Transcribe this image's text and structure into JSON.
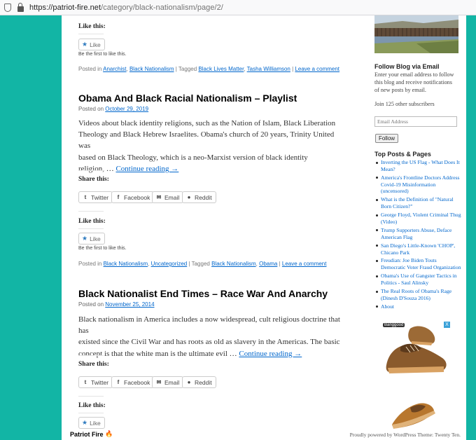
{
  "browser": {
    "url_host": "https://patriot-fire.net",
    "url_path": "/category/black-nationalism/page/2/"
  },
  "post_top": {
    "like_heading": "Like this:",
    "like_label": "Like",
    "like_note": "Be the first to like this.",
    "posted_in": "Posted in",
    "categories": [
      "Anarchist",
      "Black Nationalism"
    ],
    "tagged": "Tagged",
    "tags": [
      "Black Lives Matter",
      "Tasha Williamson"
    ],
    "leave_comment": "Leave a comment"
  },
  "post_1": {
    "title": "Obama And Black Racial Nationalism – Playlist",
    "posted_on": "Posted on",
    "date": "October 29, 2019",
    "excerpt_1": "Videos about black identity religions, such as the Nation of Islam, Black Liberation",
    "excerpt_2": "Theology and Black Hebrew Israelites. Obama's church of 20 years, Trinity United was",
    "excerpt_3": "based on Black Theology, which is a neo-Marxist version of black identity",
    "excerpt_4": "religion, …",
    "continue": "Continue reading →",
    "share_heading": "Share this:",
    "share": [
      "Twitter",
      "Facebook",
      "Email",
      "Reddit"
    ],
    "like_heading": "Like this:",
    "like_label": "Like",
    "like_note": "Be the first to like this.",
    "posted_in": "Posted in",
    "categories": [
      "Black Nationalism",
      "Uncategorized"
    ],
    "tagged": "Tagged",
    "tags": [
      "Black Nationalism",
      "Obama"
    ],
    "leave_comment": "Leave a comment"
  },
  "post_2": {
    "title": "Black Nationalist End Times – Race War And Anarchy",
    "posted_on": "Posted on",
    "date": "November 25, 2014",
    "excerpt_1": "Black nationalism in America includes a now widespread, cult religious doctrine that has",
    "excerpt_2": "existed since the Civil War and has roots as old as slavery in the Americas. The basic",
    "excerpt_3": "concept is that the white man is the ultimate evil …",
    "continue": "Continue reading →",
    "share_heading": "Share this:",
    "share": [
      "Twitter",
      "Facebook",
      "Email",
      "Reddit"
    ],
    "like_heading": "Like this:",
    "like_label": "Like"
  },
  "sidebar": {
    "follow_heading": "Follow Blog via Email",
    "follow_text": "Enter your email address to follow this blog and receive notifications of new posts by email.",
    "subscribers": "Join 125 other subscribers",
    "email_placeholder": "Email Address",
    "follow_button": "Follow",
    "top_heading": "Top Posts & Pages",
    "top_posts": [
      "Inverting the US Flag - What Does It Mean?",
      "America's Frontline Doctors Address Covid-19 Misinformation (uncensored)",
      "What is the Definition of \"Natural Born Citizen?\"",
      "George Floyd, Violent Criminal Thug (Video)",
      "Trump Supporters Abuse, Deface American Flag",
      "San Diego's Little-Known 'CHOP', Chicano Park",
      "Freudian: Joe Biden Touts Democratic Voter Fraud Organization",
      "Obama's Use of Gangster Tactics in Politics - Saul Alinsky",
      "The Real Roots of Obama's Rage (Dinesh D'Souza 2016)",
      "About"
    ],
    "ad_badge": "Banggood",
    "ad_close": "X"
  },
  "footer": {
    "site_name": "Patriot Fire",
    "powered": "Proudly powered by WordPress Theme: Twenty Ten."
  },
  "colors": {
    "teal": "#12b5a5",
    "link": "#0066cc"
  }
}
